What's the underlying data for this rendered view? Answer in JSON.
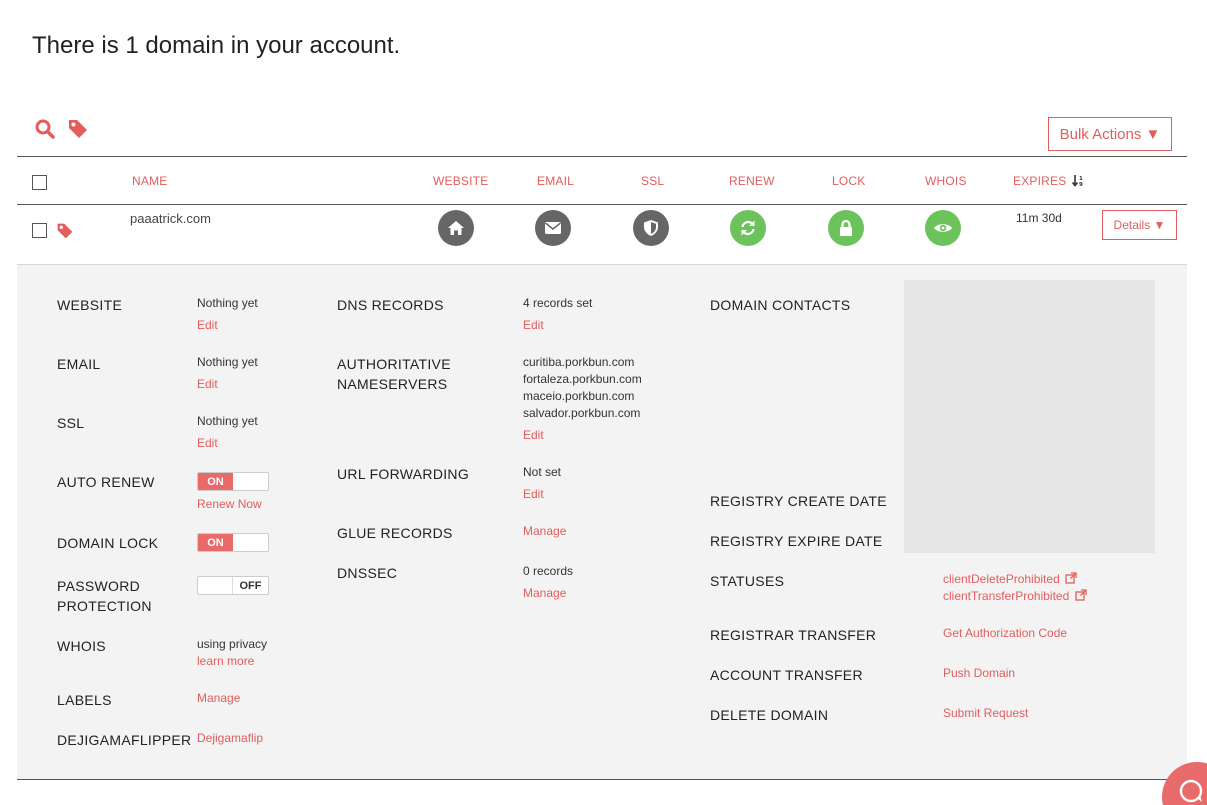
{
  "page_title": "There is 1 domain in your account.",
  "toolbar": {
    "search_icon": "search-icon",
    "tag_icon": "tag-icon",
    "bulk_actions_label": "Bulk Actions ▼"
  },
  "table": {
    "headers": {
      "name": "NAME",
      "website": "WEBSITE",
      "email": "EMAIL",
      "ssl": "SSL",
      "renew": "RENEW",
      "lock": "LOCK",
      "whois": "WHOIS",
      "expires": "EXPIRES"
    },
    "row": {
      "domain": "paaatrick.com",
      "expires": "11m 30d",
      "details_label": "Details ▼"
    }
  },
  "details": {
    "left": {
      "website_label": "WEBSITE",
      "website_value": "Nothing yet",
      "website_link": "Edit",
      "email_label": "EMAIL",
      "email_value": "Nothing yet",
      "email_link": "Edit",
      "ssl_label": "SSL",
      "ssl_value": "Nothing yet",
      "ssl_link": "Edit",
      "auto_renew_label": "AUTO RENEW",
      "auto_renew_toggle": "ON",
      "renew_now_link": "Renew Now",
      "domain_lock_label": "DOMAIN LOCK",
      "domain_lock_toggle": "ON",
      "password_label_1": "PASSWORD",
      "password_label_2": "PROTECTION",
      "password_toggle": "OFF",
      "whois_label": "WHOIS",
      "whois_value": "using privacy",
      "whois_link": "learn more",
      "labels_label": "LABELS",
      "labels_link": "Manage",
      "dejigama_label": "DEJIGAMAFLIPPER",
      "dejigama_link": "Dejigamaflip"
    },
    "middle": {
      "dns_label": "DNS RECORDS",
      "dns_value": "4 records set",
      "dns_link": "Edit",
      "ns_label_1": "AUTHORITATIVE",
      "ns_label_2": "NAMESERVERS",
      "nameservers": [
        "curitiba.porkbun.com",
        "fortaleza.porkbun.com",
        "maceio.porkbun.com",
        "salvador.porkbun.com"
      ],
      "ns_link": "Edit",
      "url_label": "URL FORWARDING",
      "url_value": "Not set",
      "url_link": "Edit",
      "glue_label": "GLUE RECORDS",
      "glue_link": "Manage",
      "dnssec_label": "DNSSEC",
      "dnssec_value": "0 records",
      "dnssec_link": "Manage"
    },
    "right": {
      "contacts_label": "DOMAIN CONTACTS",
      "create_label": "REGISTRY CREATE DATE",
      "expire_label": "REGISTRY EXPIRE DATE",
      "statuses_label": "STATUSES",
      "statuses": [
        "clientDeleteProhibited",
        "clientTransferProhibited"
      ],
      "registrar_label": "REGISTRAR TRANSFER",
      "registrar_link": "Get Authorization Code",
      "account_label": "ACCOUNT TRANSFER",
      "account_link": "Push Domain",
      "delete_label": "DELETE DOMAIN",
      "delete_link": "Submit Request"
    }
  },
  "colors": {
    "accent": "#e25d5d",
    "icon_grey": "#666666",
    "icon_green": "#6cc35c",
    "panel_bg": "#f3f3f3"
  }
}
